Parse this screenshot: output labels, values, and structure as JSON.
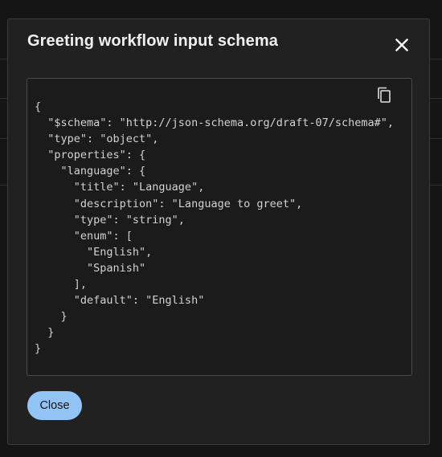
{
  "modal": {
    "title": "Greeting workflow input schema",
    "close_icon": "close-icon",
    "copy_icon": "copy-icon",
    "code": "{\n  \"$schema\": \"http://json-schema.org/draft-07/schema#\",\n  \"type\": \"object\",\n  \"properties\": {\n    \"language\": {\n      \"title\": \"Language\",\n      \"description\": \"Language to greet\",\n      \"type\": \"string\",\n      \"enum\": [\n        \"English\",\n        \"Spanish\"\n      ],\n      \"default\": \"English\"\n    }\n  }\n}",
    "close_button_label": "Close"
  },
  "colors": {
    "background": "#151515",
    "modal_background": "#212121",
    "code_background": "#1b1b1b",
    "primary_button": "#92c5f5"
  }
}
